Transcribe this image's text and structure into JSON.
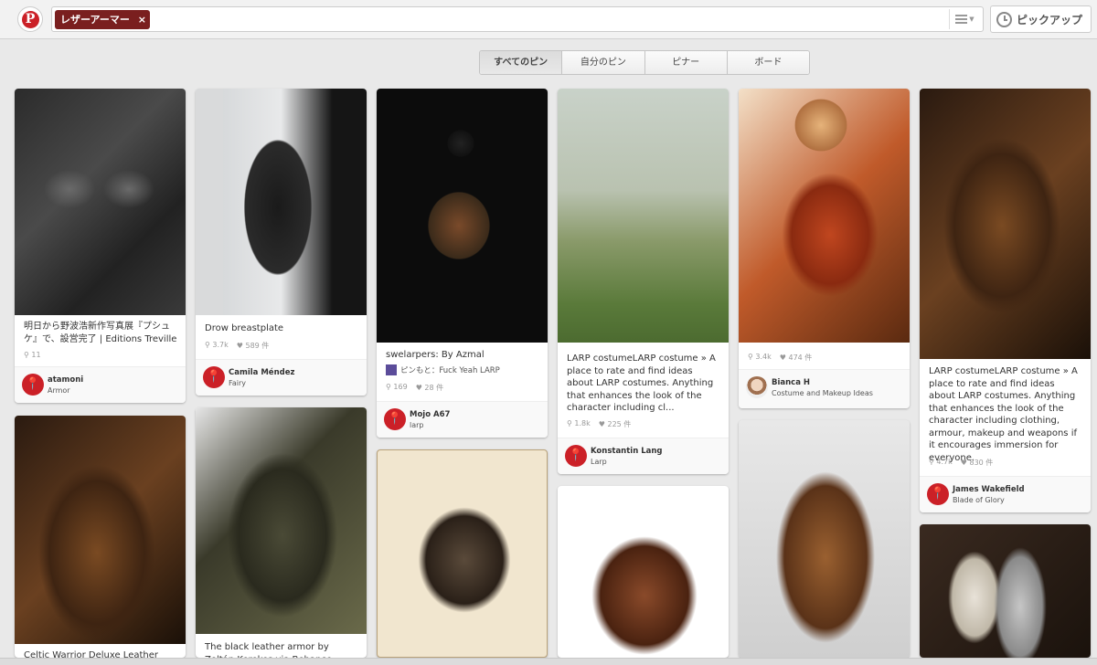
{
  "header": {
    "logo_letter": "P",
    "search_token": "レザーアーマー",
    "token_close": "×",
    "pickup_label": "ピックアップ"
  },
  "tabs": [
    "すべてのピン",
    "自分のピン",
    "ピナー",
    "ボード"
  ],
  "pins": [
    {
      "desc": "明日から野波浩新作写真展『プシュケ』で、設営完了 | Editions Treville",
      "repins": "11",
      "likes": "",
      "name": "atamoni",
      "board": "Armor"
    },
    {
      "desc": "Drow breastplate",
      "repins": "3.7k",
      "likes": "589 件",
      "name": "Camila Méndez",
      "board": "Fairy"
    },
    {
      "desc": "swelarpers: By Azmal",
      "via": "ピンもと：Fuck Yeah LARP",
      "repins": "169",
      "likes": "28 件",
      "name": "Mojo A67",
      "board": "larp"
    },
    {
      "desc": "LARP costumeLARP costume » A place to rate and find ideas about LARP costumes. Anything that enhances the look of the character including cl...",
      "repins": "1.8k",
      "likes": "225 件",
      "name": "Konstantin Lang",
      "board": "Larp"
    },
    {
      "desc": "",
      "repins": "3.4k",
      "likes": "474 件",
      "name": "Bianca H",
      "board": "Costume and Makeup Ideas"
    },
    {
      "desc": "LARP costumeLARP costume » A place to rate and find ideas about LARP costumes. Anything that enhances the look of the character including clothing, armour, makeup and weapons if it encourages immersion for everyone.",
      "repins": "4.7k",
      "likes": "830 件",
      "name": "James Wakefield",
      "board": "Blade of Glory"
    },
    {
      "desc": "Celtic Warrior Deluxe Leather Armour"
    },
    {
      "desc": "The black leather armor by Zoltán Kerekes via Behance"
    }
  ],
  "colors": {
    "brand": "#cb2027",
    "token_bg": "#7a1f1f",
    "page_bg": "#e9e9e9"
  },
  "icons": [
    "pinterest-logo-icon",
    "close-icon",
    "menu-icon",
    "clock-icon",
    "pin-icon",
    "heart-icon"
  ]
}
